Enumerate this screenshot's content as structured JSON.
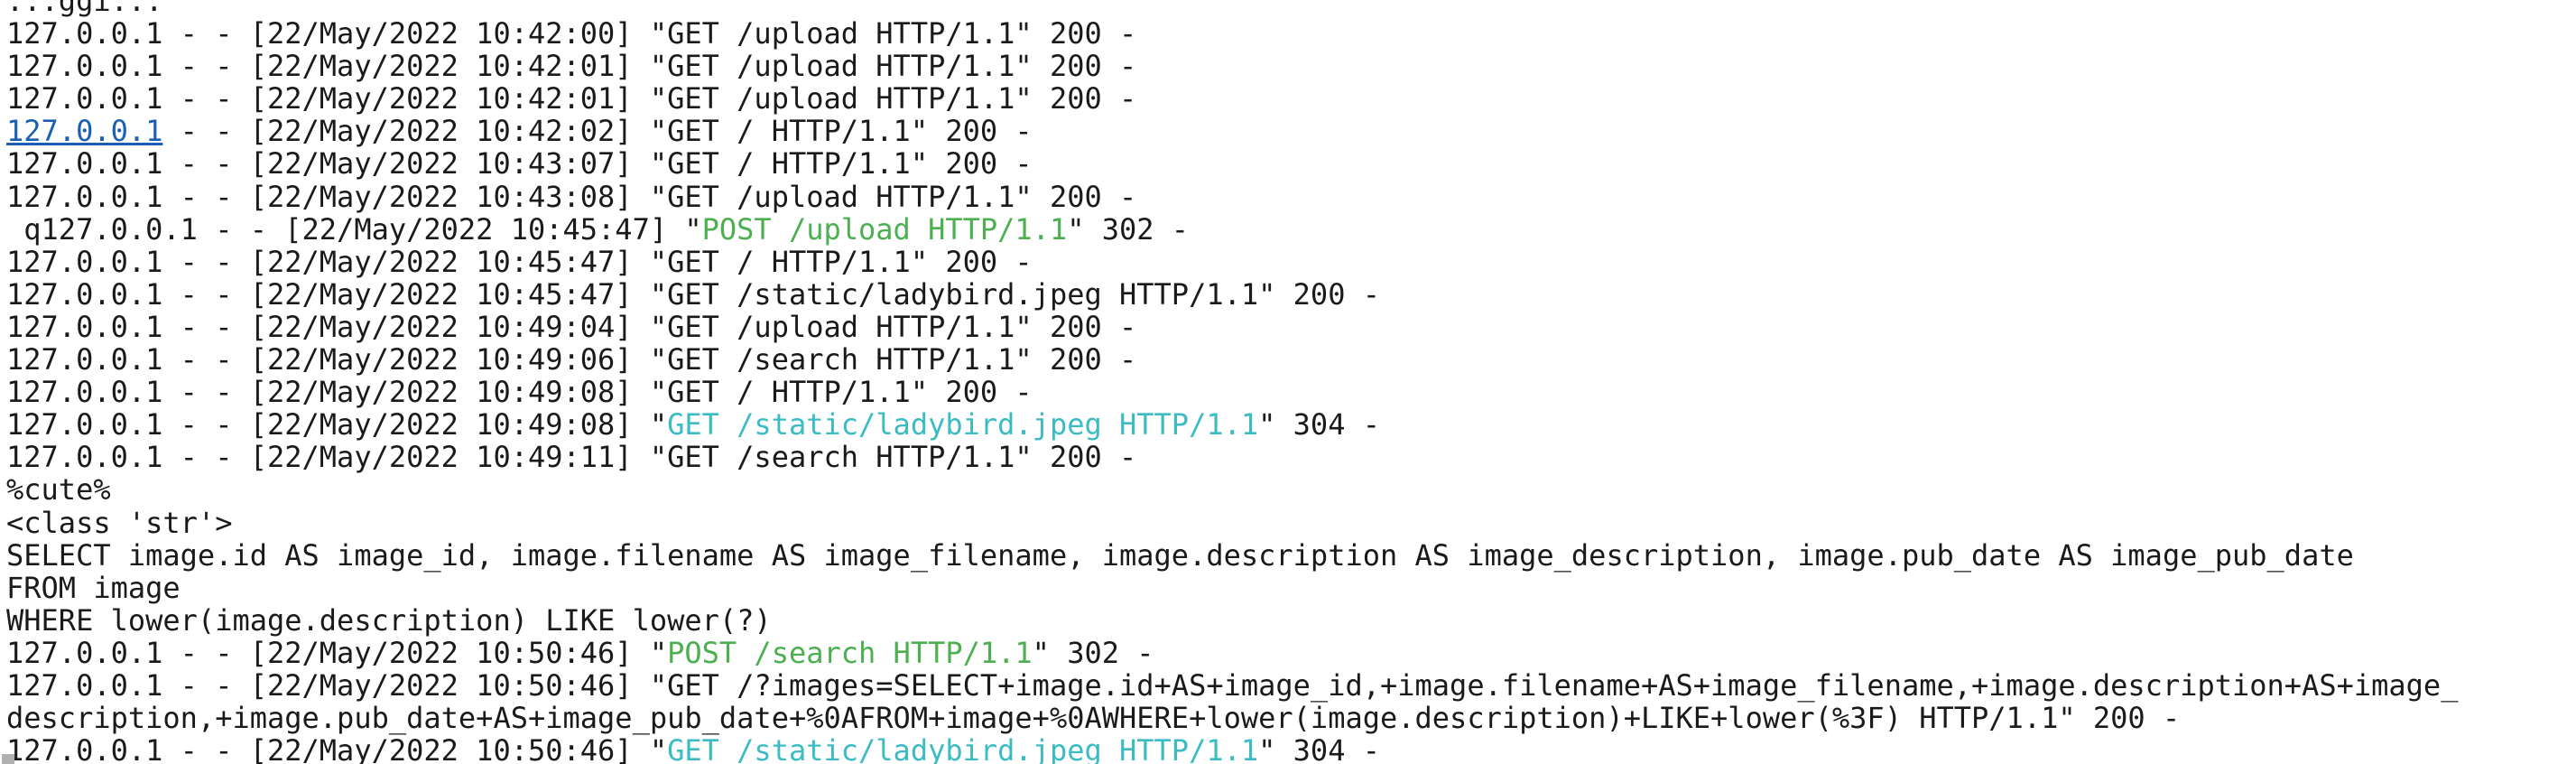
{
  "terminal": {
    "lines": [
      [
        {
          "text": "...ggi...",
          "color": "default"
        }
      ],
      [
        {
          "text": "127.0.0.1 - - [22/May/2022 10:42:00] \"GET /upload HTTP/1.1\" 200 -",
          "color": "default"
        }
      ],
      [
        {
          "text": "127.0.0.1 - - [22/May/2022 10:42:01] \"GET /upload HTTP/1.1\" 200 -",
          "color": "default"
        }
      ],
      [
        {
          "text": "127.0.0.1 - - [22/May/2022 10:42:01] \"GET /upload HTTP/1.1\" 200 -",
          "color": "default"
        }
      ],
      [
        {
          "text": "127.0.0.1",
          "color": "link"
        },
        {
          "text": " - - [22/May/2022 10:42:02] \"GET / HTTP/1.1\" 200 -",
          "color": "default"
        }
      ],
      [
        {
          "text": "127.0.0.1 - - [22/May/2022 10:43:07] \"GET / HTTP/1.1\" 200 -",
          "color": "default"
        }
      ],
      [
        {
          "text": "127.0.0.1 - - [22/May/2022 10:43:08] \"GET /upload HTTP/1.1\" 200 -",
          "color": "default"
        }
      ],
      [
        {
          "text": " q127.0.0.1 - - [22/May/2022 10:45:47] \"",
          "color": "default"
        },
        {
          "text": "POST /upload HTTP/1.1",
          "color": "green"
        },
        {
          "text": "\" 302 -",
          "color": "default"
        }
      ],
      [
        {
          "text": "127.0.0.1 - - [22/May/2022 10:45:47] \"GET / HTTP/1.1\" 200 -",
          "color": "default"
        }
      ],
      [
        {
          "text": "127.0.0.1 - - [22/May/2022 10:45:47] \"GET /static/ladybird.jpeg HTTP/1.1\" 200 -",
          "color": "default"
        }
      ],
      [
        {
          "text": "127.0.0.1 - - [22/May/2022 10:49:04] \"GET /upload HTTP/1.1\" 200 -",
          "color": "default"
        }
      ],
      [
        {
          "text": "127.0.0.1 - - [22/May/2022 10:49:06] \"GET /search HTTP/1.1\" 200 -",
          "color": "default"
        }
      ],
      [
        {
          "text": "127.0.0.1 - - [22/May/2022 10:49:08] \"GET / HTTP/1.1\" 200 -",
          "color": "default"
        }
      ],
      [
        {
          "text": "127.0.0.1 - - [22/May/2022 10:49:08] \"",
          "color": "default"
        },
        {
          "text": "GET /static/ladybird.jpeg HTTP/1.1",
          "color": "cyan"
        },
        {
          "text": "\" 304 -",
          "color": "default"
        }
      ],
      [
        {
          "text": "127.0.0.1 - - [22/May/2022 10:49:11] \"GET /search HTTP/1.1\" 200 -",
          "color": "default"
        }
      ],
      [
        {
          "text": "%cute%",
          "color": "default"
        }
      ],
      [
        {
          "text": "<class 'str'>",
          "color": "default"
        }
      ],
      [
        {
          "text": "SELECT image.id AS image_id, image.filename AS image_filename, image.description AS image_description, image.pub_date AS image_pub_date",
          "color": "default"
        }
      ],
      [
        {
          "text": "FROM image",
          "color": "default"
        }
      ],
      [
        {
          "text": "WHERE lower(image.description) LIKE lower(?)",
          "color": "default"
        }
      ],
      [
        {
          "text": "127.0.0.1 - - [22/May/2022 10:50:46] \"",
          "color": "default"
        },
        {
          "text": "POST /search HTTP/1.1",
          "color": "green"
        },
        {
          "text": "\" 302 -",
          "color": "default"
        }
      ],
      [
        {
          "text": "127.0.0.1 - - [22/May/2022 10:50:46] \"GET /?images=SELECT+image.id+AS+image_id,+image.filename+AS+image_filename,+image.description+AS+image_",
          "color": "default"
        }
      ],
      [
        {
          "text": "description,+image.pub_date+AS+image_pub_date+%0AFROM+image+%0AWHERE+lower(image.description)+LIKE+lower(%3F) HTTP/1.1\" 200 -",
          "color": "default"
        }
      ],
      [
        {
          "text": "127.0.0.1 - - [22/May/2022 10:50:46] \"",
          "color": "default"
        },
        {
          "text": "GET /static/ladybird.jpeg HTTP/1.1",
          "color": "cyan"
        },
        {
          "text": "\" 304 -",
          "color": "default"
        }
      ]
    ]
  },
  "colors": {
    "background": "#ffffff",
    "default": "#1a1a1a",
    "green": "#4caf50",
    "cyan": "#3bbcc4",
    "link": "#1a5fb4",
    "cursor": "#b0b0b0"
  }
}
